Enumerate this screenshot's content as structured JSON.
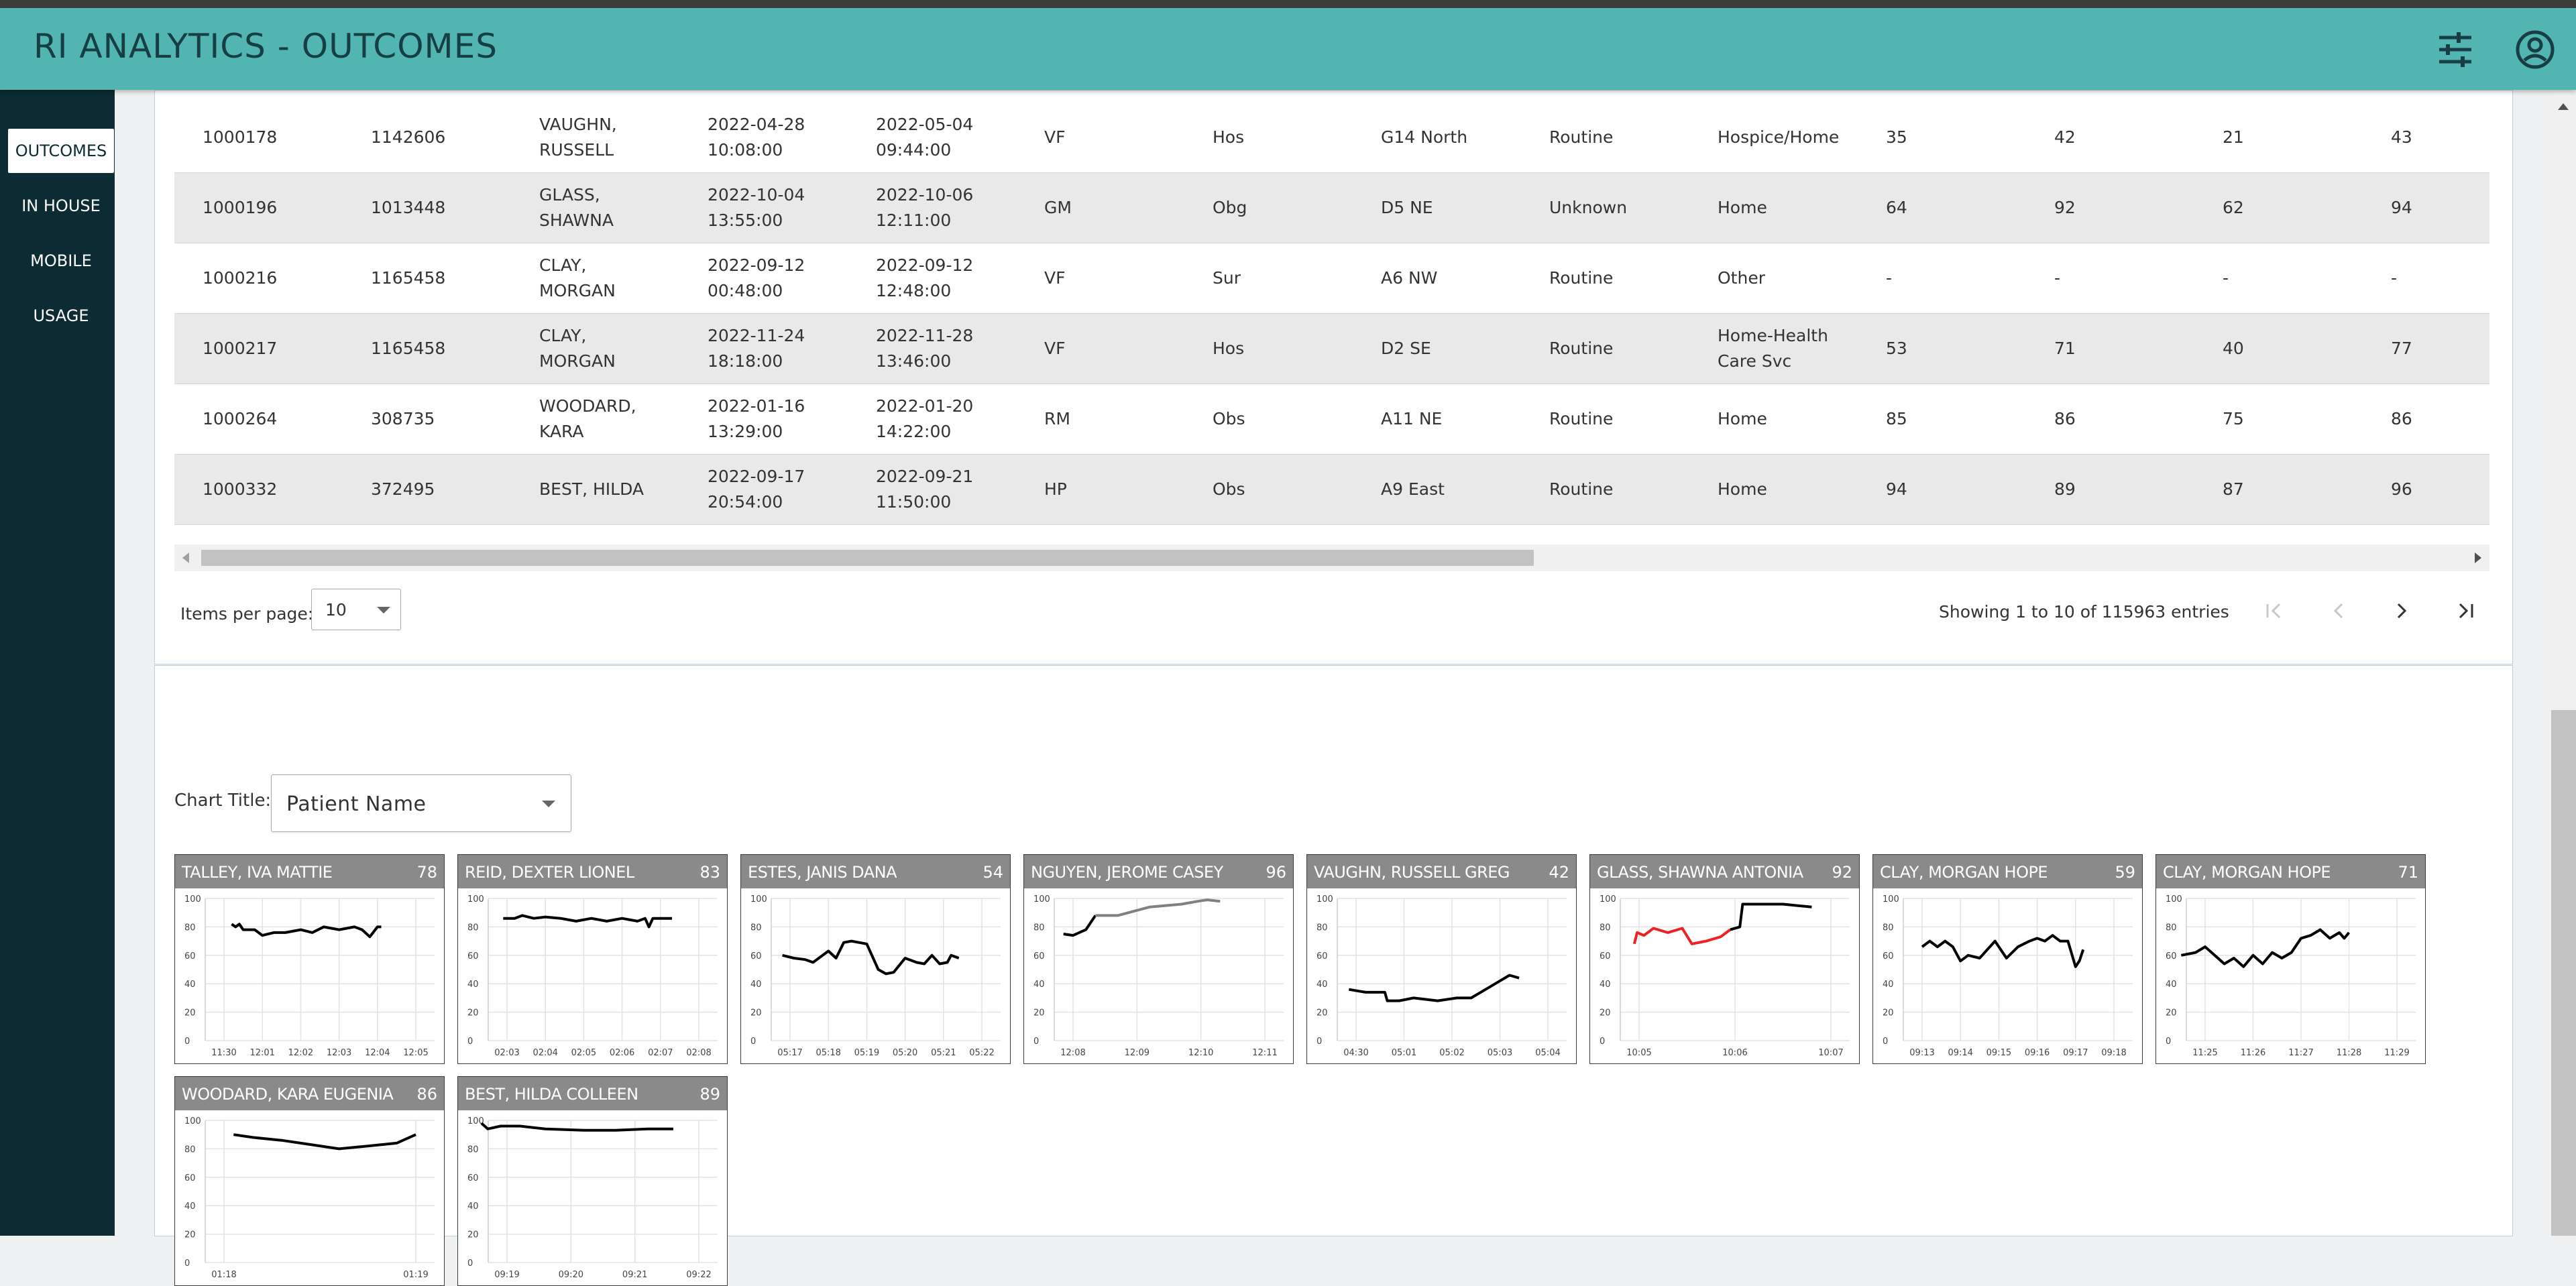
{
  "app": {
    "title": "RI ANALYTICS - OUTCOMES",
    "accent_color": "#52b5b1",
    "sidebar_color": "#0d2b33",
    "icons": [
      "settings-sliders-icon",
      "user-account-icon"
    ]
  },
  "sidebar": {
    "items": [
      {
        "label": "OUTCOMES",
        "active": true
      },
      {
        "label": "IN HOUSE"
      },
      {
        "label": "MOBILE"
      },
      {
        "label": "USAGE"
      }
    ]
  },
  "table": {
    "rows": [
      [
        "1000178",
        "1142606",
        "VAUGHN,\nRUSSELL",
        "2022-04-28\n10:08:00",
        "2022-05-04\n09:44:00",
        "VF",
        "Hos",
        "G14 North",
        "Routine",
        "Hospice/Home",
        "35",
        "42",
        "21",
        "43"
      ],
      [
        "1000196",
        "1013448",
        "GLASS,\nSHAWNA",
        "2022-10-04\n13:55:00",
        "2022-10-06\n12:11:00",
        "GM",
        "Obg",
        "D5 NE",
        "Unknown",
        "Home",
        "64",
        "92",
        "62",
        "94"
      ],
      [
        "1000216",
        "1165458",
        "CLAY,\nMORGAN",
        "2022-09-12\n00:48:00",
        "2022-09-12\n12:48:00",
        "VF",
        "Sur",
        "A6 NW",
        "Routine",
        "Other",
        "-",
        "-",
        "-",
        "-"
      ],
      [
        "1000217",
        "1165458",
        "CLAY,\nMORGAN",
        "2022-11-24\n18:18:00",
        "2022-11-28\n13:46:00",
        "VF",
        "Hos",
        "D2 SE",
        "Routine",
        "Home-Health\nCare Svc",
        "53",
        "71",
        "40",
        "77"
      ],
      [
        "1000264",
        "308735",
        "WOODARD,\nKARA",
        "2022-01-16\n13:29:00",
        "2022-01-20\n14:22:00",
        "RM",
        "Obs",
        "A11 NE",
        "Routine",
        "Home",
        "85",
        "86",
        "75",
        "86"
      ],
      [
        "1000332",
        "372495",
        "BEST, HILDA",
        "2022-09-17\n20:54:00",
        "2022-09-21\n11:50:00",
        "HP",
        "Obs",
        "A9 East",
        "Routine",
        "Home",
        "94",
        "89",
        "87",
        "96"
      ]
    ]
  },
  "pagination": {
    "items_per_page_label": "Items per page:",
    "items_per_page_value": "10",
    "showing_text": "Showing 1 to 10 of 115963 entries",
    "icons": [
      "first-page-icon",
      "previous-page-icon",
      "next-page-icon",
      "last-page-icon"
    ]
  },
  "chart_panel": {
    "title_label": "Chart Title:",
    "title_value": "Patient Name"
  },
  "chart_data": [
    {
      "type": "line",
      "title": "TALLEY, IVA MATTIE",
      "score": "78",
      "ylim": [
        0,
        100
      ],
      "yticks": [
        "100",
        "80",
        "60",
        "40",
        "20",
        "0"
      ],
      "xticks": [
        "11:30",
        "12:01",
        "12:02",
        "12:03",
        "12:04",
        "12:05"
      ],
      "grid": true,
      "series": [
        {
          "color": "#000000",
          "values": [
            [
              0.2,
              82
            ],
            [
              0.3,
              80
            ],
            [
              0.4,
              82
            ],
            [
              0.5,
              78
            ],
            [
              0.8,
              78
            ],
            [
              1.0,
              74
            ],
            [
              1.3,
              76
            ],
            [
              1.6,
              76
            ],
            [
              2.0,
              78
            ],
            [
              2.3,
              76
            ],
            [
              2.6,
              80
            ],
            [
              3.0,
              78
            ],
            [
              3.4,
              80
            ],
            [
              3.6,
              78
            ],
            [
              3.8,
              73
            ],
            [
              4.0,
              80
            ],
            [
              4.1,
              80
            ]
          ]
        }
      ]
    },
    {
      "type": "line",
      "title": "REID, DEXTER LIONEL",
      "score": "83",
      "ylim": [
        0,
        100
      ],
      "yticks": [
        "100",
        "80",
        "60",
        "40",
        "20",
        "0"
      ],
      "xticks": [
        "02:03",
        "02:04",
        "02:05",
        "02:06",
        "02:07",
        "02:08"
      ],
      "grid": true,
      "series": [
        {
          "color": "#000000",
          "values": [
            [
              -0.1,
              86
            ],
            [
              0.2,
              86
            ],
            [
              0.4,
              88
            ],
            [
              0.7,
              86
            ],
            [
              1.0,
              87
            ],
            [
              1.4,
              86
            ],
            [
              1.8,
              84
            ],
            [
              2.2,
              86
            ],
            [
              2.6,
              84
            ],
            [
              3.0,
              86
            ],
            [
              3.4,
              84
            ],
            [
              3.6,
              86
            ],
            [
              3.7,
              80
            ],
            [
              3.8,
              86
            ],
            [
              4.3,
              86
            ]
          ]
        }
      ]
    },
    {
      "type": "line",
      "title": "ESTES, JANIS DANA",
      "score": "54",
      "ylim": [
        0,
        100
      ],
      "yticks": [
        "100",
        "80",
        "60",
        "40",
        "20",
        "0"
      ],
      "xticks": [
        "05:17",
        "05:18",
        "05:19",
        "05:20",
        "05:21",
        "05:22"
      ],
      "grid": true,
      "series": [
        {
          "color": "#000000",
          "values": [
            [
              -0.2,
              60
            ],
            [
              0.1,
              58
            ],
            [
              0.4,
              57
            ],
            [
              0.6,
              55
            ],
            [
              0.8,
              59
            ],
            [
              1.0,
              63
            ],
            [
              1.2,
              58
            ],
            [
              1.4,
              69
            ],
            [
              1.6,
              70
            ],
            [
              2.0,
              68
            ],
            [
              2.3,
              50
            ],
            [
              2.5,
              47
            ],
            [
              2.7,
              48
            ],
            [
              3.0,
              58
            ],
            [
              3.3,
              55
            ],
            [
              3.5,
              54
            ],
            [
              3.7,
              60
            ],
            [
              3.9,
              54
            ],
            [
              4.1,
              55
            ],
            [
              4.2,
              60
            ],
            [
              4.4,
              58
            ]
          ]
        }
      ]
    },
    {
      "type": "line",
      "title": "NGUYEN, JEROME CASEY",
      "score": "96",
      "ylim": [
        0,
        100
      ],
      "yticks": [
        "100",
        "80",
        "60",
        "40",
        "20",
        "0"
      ],
      "xticks": [
        "12:08",
        "12:09",
        "12:10",
        "12:11"
      ],
      "grid": true,
      "series": [
        {
          "color": "#000000",
          "values": [
            [
              -0.15,
              75
            ],
            [
              0.0,
              74
            ],
            [
              0.2,
              78
            ],
            [
              0.35,
              88
            ]
          ]
        },
        {
          "color": "#808080",
          "values": [
            [
              0.35,
              88
            ],
            [
              0.7,
              88
            ],
            [
              1.2,
              94
            ],
            [
              1.7,
              96
            ],
            [
              1.95,
              98
            ],
            [
              2.1,
              99
            ],
            [
              2.3,
              98
            ]
          ]
        }
      ]
    },
    {
      "type": "line",
      "title": "VAUGHN, RUSSELL GREG",
      "score": "42",
      "ylim": [
        0,
        100
      ],
      "yticks": [
        "100",
        "80",
        "60",
        "40",
        "20",
        "0"
      ],
      "xticks": [
        "04:30",
        "05:01",
        "05:02",
        "05:03",
        "05:04"
      ],
      "grid": true,
      "series": [
        {
          "color": "#000000",
          "values": [
            [
              -0.15,
              36
            ],
            [
              0.2,
              34
            ],
            [
              0.6,
              34
            ],
            [
              0.65,
              28
            ],
            [
              0.9,
              28
            ],
            [
              1.2,
              30
            ],
            [
              1.7,
              28
            ],
            [
              2.1,
              30
            ],
            [
              2.4,
              30
            ],
            [
              2.7,
              36
            ],
            [
              2.9,
              40
            ],
            [
              3.2,
              46
            ],
            [
              3.4,
              44
            ]
          ]
        }
      ]
    },
    {
      "type": "line",
      "title": "GLASS, SHAWNA ANTONIA",
      "score": "92",
      "ylim": [
        0,
        100
      ],
      "yticks": [
        "100",
        "80",
        "60",
        "40",
        "20",
        "0"
      ],
      "xticks": [
        "10:05",
        "10:06",
        "10:07"
      ],
      "grid": true,
      "series": [
        {
          "color": "#ee2222",
          "values": [
            [
              -0.05,
              68
            ],
            [
              -0.02,
              76
            ],
            [
              0.05,
              74
            ],
            [
              0.15,
              79
            ],
            [
              0.3,
              76
            ],
            [
              0.45,
              79
            ],
            [
              0.55,
              68
            ],
            [
              0.7,
              70
            ],
            [
              0.85,
              73
            ],
            [
              0.95,
              78
            ]
          ]
        },
        {
          "color": "#000000",
          "values": [
            [
              0.95,
              78
            ],
            [
              1.05,
              80
            ],
            [
              1.08,
              96
            ],
            [
              1.5,
              96
            ],
            [
              1.8,
              94
            ]
          ]
        }
      ]
    },
    {
      "type": "line",
      "title": "CLAY, MORGAN HOPE",
      "score": "59",
      "ylim": [
        0,
        100
      ],
      "yticks": [
        "100",
        "80",
        "60",
        "40",
        "20",
        "0"
      ],
      "xticks": [
        "09:13",
        "09:14",
        "09:15",
        "09:16",
        "09:17",
        "09:18"
      ],
      "grid": true,
      "series": [
        {
          "color": "#000000",
          "values": [
            [
              0.0,
              66
            ],
            [
              0.2,
              70
            ],
            [
              0.4,
              66
            ],
            [
              0.6,
              70
            ],
            [
              0.8,
              66
            ],
            [
              1.0,
              56
            ],
            [
              1.2,
              60
            ],
            [
              1.5,
              58
            ],
            [
              1.7,
              64
            ],
            [
              1.9,
              70
            ],
            [
              2.2,
              58
            ],
            [
              2.5,
              66
            ],
            [
              2.8,
              70
            ],
            [
              3.0,
              72
            ],
            [
              3.2,
              70
            ],
            [
              3.4,
              74
            ],
            [
              3.6,
              70
            ],
            [
              3.8,
              70
            ],
            [
              4.0,
              52
            ],
            [
              4.1,
              56
            ],
            [
              4.2,
              64
            ]
          ]
        }
      ]
    },
    {
      "type": "line",
      "title": "CLAY, MORGAN HOPE",
      "score": "71",
      "ylim": [
        0,
        100
      ],
      "yticks": [
        "100",
        "80",
        "60",
        "40",
        "20",
        "0"
      ],
      "xticks": [
        "11:25",
        "11:26",
        "11:27",
        "11:28",
        "11:29"
      ],
      "grid": true,
      "series": [
        {
          "color": "#000000",
          "values": [
            [
              -0.5,
              60
            ],
            [
              -0.2,
              62
            ],
            [
              0.0,
              66
            ],
            [
              0.2,
              60
            ],
            [
              0.4,
              54
            ],
            [
              0.6,
              58
            ],
            [
              0.8,
              52
            ],
            [
              1.0,
              60
            ],
            [
              1.2,
              54
            ],
            [
              1.4,
              62
            ],
            [
              1.6,
              58
            ],
            [
              1.8,
              62
            ],
            [
              2.0,
              72
            ],
            [
              2.2,
              74
            ],
            [
              2.4,
              78
            ],
            [
              2.6,
              72
            ],
            [
              2.8,
              76
            ],
            [
              2.9,
              72
            ],
            [
              3.0,
              76
            ]
          ]
        }
      ]
    },
    {
      "type": "line",
      "title": "WOODARD, KARA EUGENIA",
      "score": "86",
      "ylim": [
        0,
        100
      ],
      "yticks": [
        "100",
        "80",
        "60",
        "40",
        "20",
        "0"
      ],
      "xticks": [
        "01:18",
        "01:19"
      ],
      "grid": true,
      "series": [
        {
          "color": "#000000",
          "values": [
            [
              0.05,
              90
            ],
            [
              0.15,
              88
            ],
            [
              0.3,
              86
            ],
            [
              0.45,
              83
            ],
            [
              0.6,
              80
            ],
            [
              0.75,
              82
            ],
            [
              0.9,
              84
            ],
            [
              1.0,
              90
            ]
          ]
        }
      ]
    },
    {
      "type": "line",
      "title": "BEST, HILDA COLLEEN",
      "score": "89",
      "ylim": [
        0,
        100
      ],
      "yticks": [
        "100",
        "80",
        "60",
        "40",
        "20",
        "0"
      ],
      "xticks": [
        "09:19",
        "09:20",
        "09:21",
        "09:22"
      ],
      "grid": true,
      "series": [
        {
          "color": "#000000",
          "values": [
            [
              -0.4,
              98
            ],
            [
              -0.3,
              94
            ],
            [
              -0.1,
              96
            ],
            [
              0.2,
              96
            ],
            [
              0.6,
              94
            ],
            [
              1.2,
              93
            ],
            [
              1.7,
              93
            ],
            [
              2.2,
              94
            ],
            [
              2.6,
              94
            ]
          ]
        }
      ]
    }
  ]
}
